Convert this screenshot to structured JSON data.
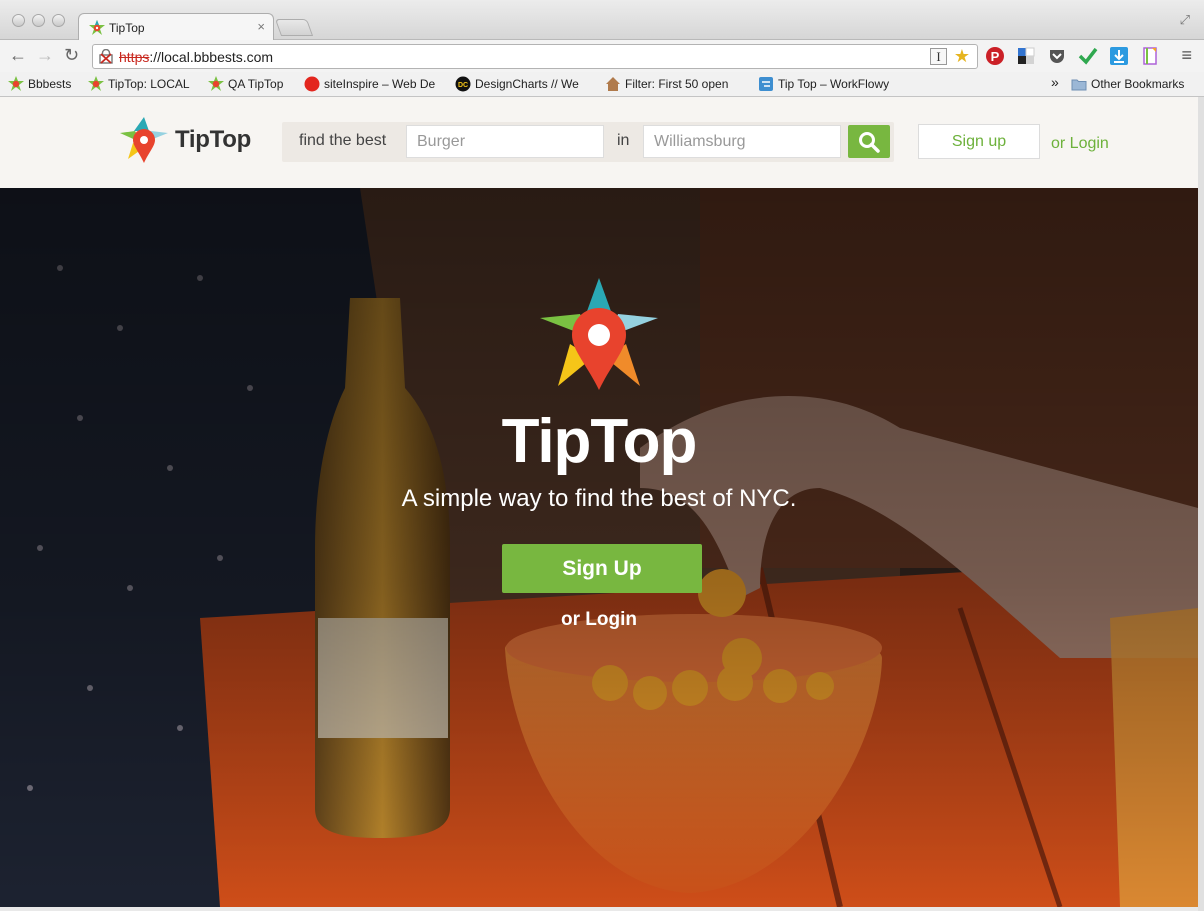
{
  "browser": {
    "tab_title": "TipTop",
    "tab_close": "×",
    "url_scheme": "https",
    "url_rest": "://local.bbbests.com",
    "reader_glyph": "I",
    "star_glyph": "★",
    "menu_glyph": "≡",
    "bookmarks": [
      {
        "label": "Bbbests",
        "icon": "tiptop-favicon"
      },
      {
        "label": "TipTop: LOCAL",
        "icon": "tiptop-favicon"
      },
      {
        "label": "QA TipTop",
        "icon": "tiptop-favicon"
      },
      {
        "label": "siteInspire – Web De",
        "icon": "red-circle-icon"
      },
      {
        "label": "DesignCharts // We",
        "icon": "dc-icon"
      },
      {
        "label": "Filter: First 50 open",
        "icon": "house-icon"
      },
      {
        "label": "Tip Top – WorkFlowy",
        "icon": "workflowy-icon"
      }
    ],
    "bookmarks_overflow": "»",
    "other_bookmarks": "Other Bookmarks"
  },
  "header": {
    "logo_text": "TipTop",
    "find_label": "find the best",
    "what_placeholder": "Burger",
    "in_label": "in",
    "where_placeholder": "Williamsburg",
    "signup_label": "Sign up",
    "login_label": "or Login"
  },
  "hero": {
    "title": "TipTop",
    "tagline": "A simple way to find the best of NYC.",
    "signup_label": "Sign Up",
    "login_label": "or Login"
  },
  "colors": {
    "brand_green": "#78b740",
    "link_green": "#6db13b",
    "star_teal": "#2aa8b4",
    "star_green": "#7ac142",
    "star_yellow": "#f5c518",
    "pin_red": "#e8432d"
  }
}
